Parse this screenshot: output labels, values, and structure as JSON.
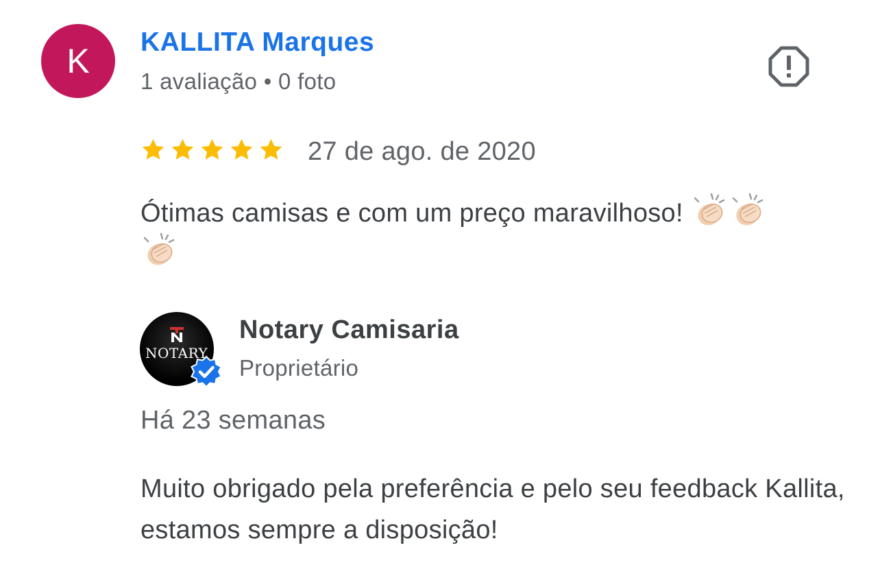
{
  "reviewer": {
    "initial": "K",
    "avatar_color": "#c2185b",
    "name": "KALLITA Marques",
    "meta": "1 avaliação • 0 foto"
  },
  "report_icon": "report-flag-icon",
  "review": {
    "rating": 5,
    "max_rating": 5,
    "star_color": "#fbbc04",
    "date": "27 de ago. de 2020",
    "text": "Ótimas camisas e com um preço maravilhoso!",
    "emoji": [
      "clapping-hands-icon",
      "clapping-hands-icon",
      "clapping-hands-icon"
    ]
  },
  "owner": {
    "logo_text": "NOTARY",
    "name": "Notary Camisaria",
    "role": "Proprietário",
    "verified_color": "#1a73e8"
  },
  "reply": {
    "time": "Há 23 semanas",
    "text": "Muito obrigado pela preferência e pelo seu feedback Kallita, estamos sempre a disposição!"
  },
  "colors": {
    "name_link": "#1a73e8",
    "secondary_text": "#5f6368",
    "primary_text": "#3c4043"
  }
}
